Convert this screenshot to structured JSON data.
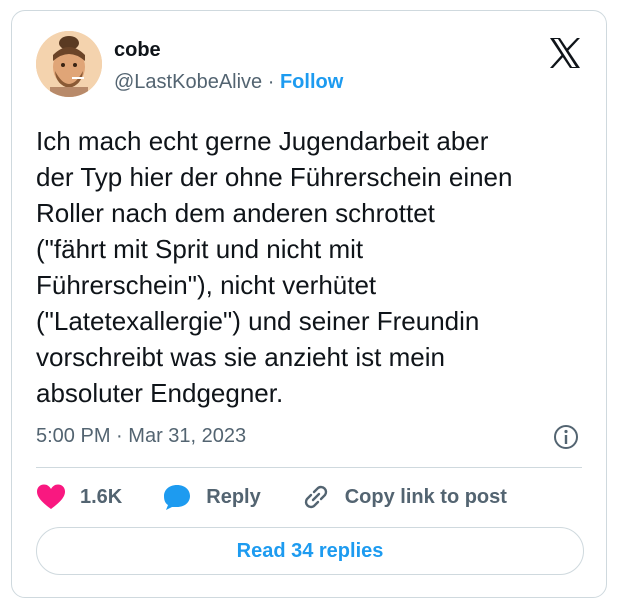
{
  "author": {
    "name": "cobe",
    "handle": "@LastKobeAlive",
    "separator": "·",
    "follow_label": "Follow"
  },
  "tweet": {
    "text": "Ich mach echt gerne Jugendarbeit aber\nder Typ hier der ohne Führerschein einen\nRoller nach dem anderen schrottet\n(\"fährt mit Sprit und nicht mit\nFührerschein\"), nicht verhütet\n(\"Latetexallergie\") und seiner Freundin\nvorschreibt was sie anzieht ist mein\nabsoluter Endgegner.",
    "time": "5:00 PM",
    "time_separator": "·",
    "date": "Mar 31, 2023"
  },
  "actions": {
    "likes_count": "1.6K",
    "reply_label": "Reply",
    "copy_link_label": "Copy link to post"
  },
  "footer": {
    "read_replies_label": "Read 34 replies"
  },
  "icons": {
    "like": "heart-icon",
    "reply": "speech-bubble-icon",
    "copy": "link-icon",
    "info": "info-icon",
    "brand": "x-logo-icon"
  },
  "colors": {
    "accent": "#1d9bf0",
    "like": "#f91880",
    "text": "#0f1419",
    "muted": "#536471",
    "border": "#cfd9de"
  }
}
